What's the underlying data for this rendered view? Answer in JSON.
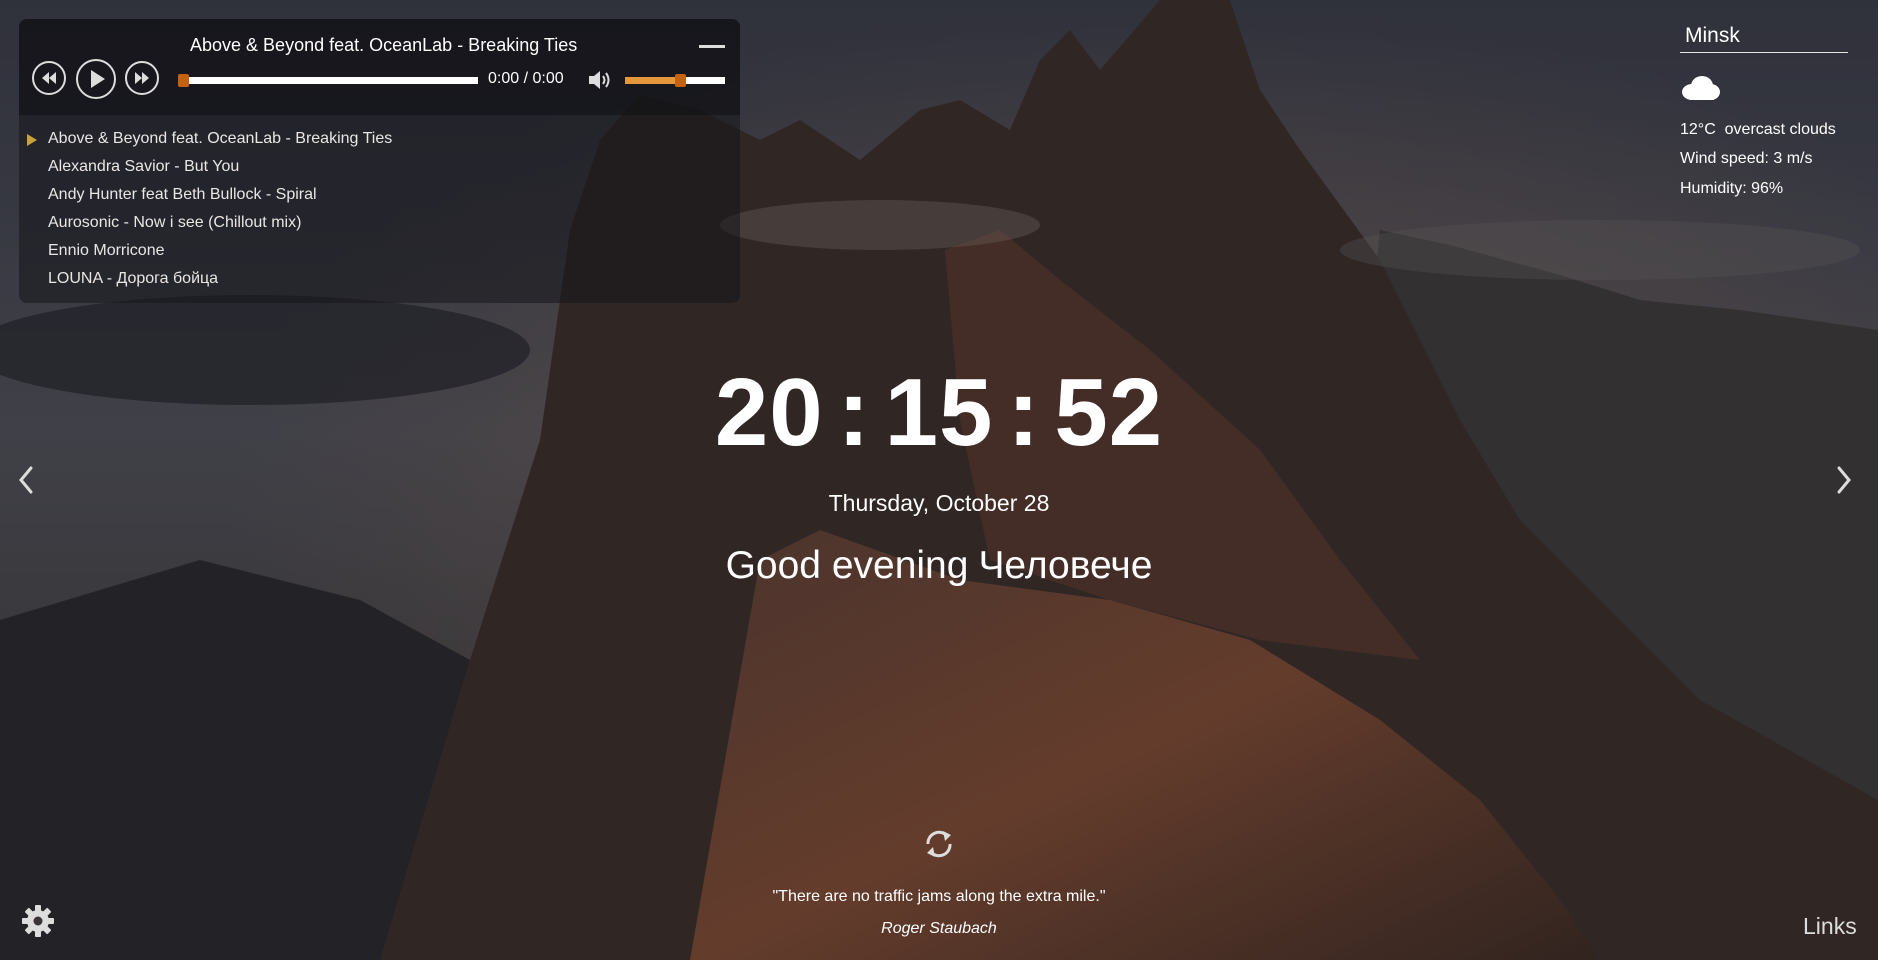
{
  "player": {
    "current_track": "Above & Beyond feat. OceanLab - Breaking Ties",
    "time": "0:00 / 0:00",
    "progress": 0,
    "volume": 0.55,
    "playlist": [
      "Above & Beyond feat. OceanLab - Breaking Ties",
      "Alexandra Savior - But You",
      "Andy Hunter feat Beth Bullock - Spiral",
      "Aurosonic - Now i see (Chillout mix)",
      "Ennio Morricone",
      "LOUNA - Дорога бойца"
    ],
    "active_index": 0
  },
  "weather": {
    "city": "Minsk",
    "icon": "cloud-icon",
    "temperature": "12°C",
    "description": "overcast clouds",
    "wind": "Wind speed: 3 m/s",
    "humidity": "Humidity: 96%"
  },
  "clock": {
    "hours": "20",
    "minutes": "15",
    "seconds": "52",
    "separator": ":"
  },
  "date": "Thursday, October 28",
  "greeting": {
    "text": "Good evening",
    "name": "Человече"
  },
  "quote": {
    "text": "\"There are no traffic jams along the extra mile.\"",
    "author": "Roger Staubach"
  },
  "footer": {
    "links_label": "Links"
  },
  "icons": {
    "settings": "gear-icon",
    "refresh": "refresh-icon",
    "prev_bg": "chevron-left-icon",
    "next_bg": "chevron-right-icon"
  },
  "colors": {
    "accent": "#c4620f",
    "volume_fill": "#e4973b",
    "playlist_marker": "#c9a23a"
  }
}
